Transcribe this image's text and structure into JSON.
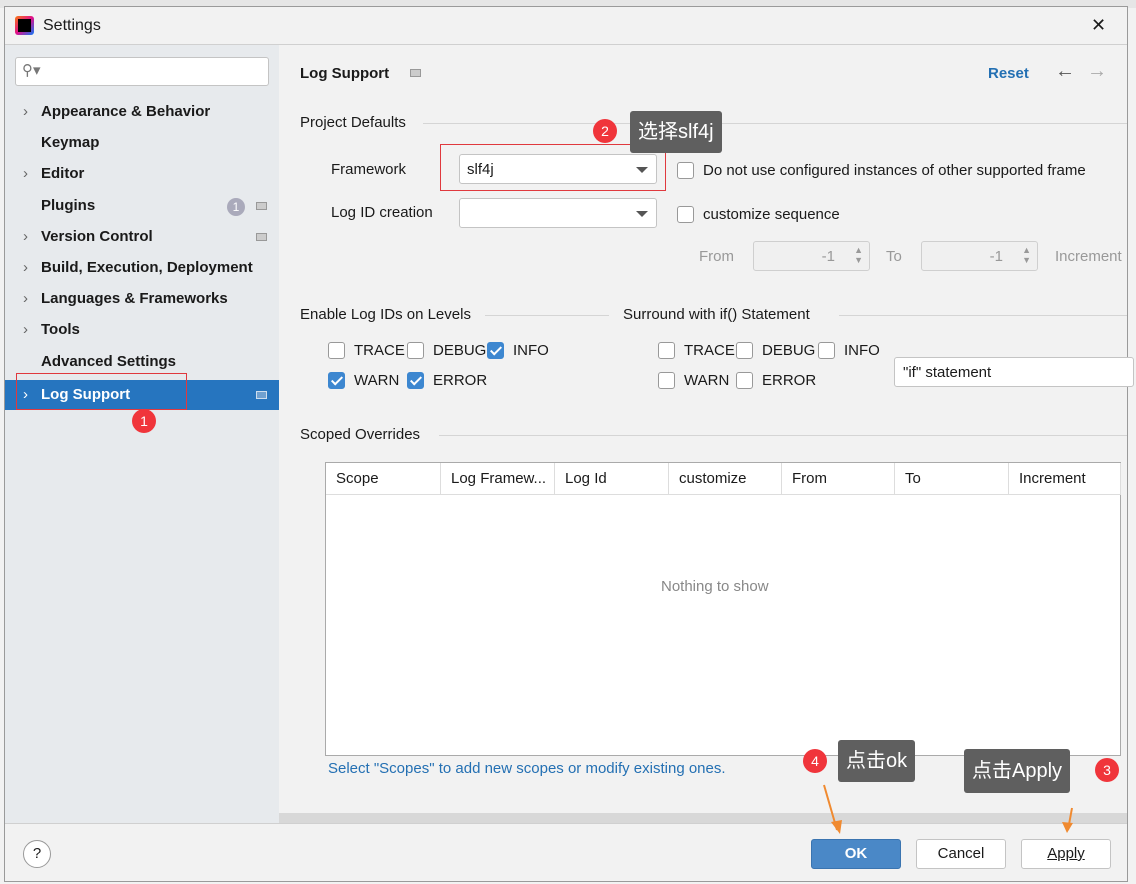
{
  "window": {
    "title": "Settings",
    "close": "✕"
  },
  "search": {
    "placeholder": ""
  },
  "sidebar": {
    "items": [
      {
        "label": "Appearance & Behavior",
        "chevron": true
      },
      {
        "label": "Keymap",
        "chevron": false
      },
      {
        "label": "Editor",
        "chevron": true
      },
      {
        "label": "Plugins",
        "chevron": false,
        "badge": "1"
      },
      {
        "label": "Version Control",
        "chevron": true
      },
      {
        "label": "Build, Execution, Deployment",
        "chevron": true
      },
      {
        "label": "Languages & Frameworks",
        "chevron": true
      },
      {
        "label": "Tools",
        "chevron": true
      },
      {
        "label": "Advanced Settings",
        "chevron": false
      },
      {
        "label": "Log Support",
        "chevron": true,
        "selected": true
      }
    ]
  },
  "header": {
    "title": "Log Support",
    "reset": "Reset"
  },
  "project_defaults": {
    "title": "Project Defaults",
    "framework_label": "Framework",
    "framework_value": "slf4j",
    "no_configured_label": "Do not use configured instances of other supported frame",
    "log_id_label": "Log ID creation",
    "log_id_value": "",
    "customize_label": "customize sequence",
    "from_label": "From",
    "from_value": "-1",
    "to_label": "To",
    "to_value": "-1",
    "increment_label": "Increment"
  },
  "levels": {
    "title": "Enable Log IDs on Levels",
    "items": [
      {
        "label": "TRACE",
        "checked": false
      },
      {
        "label": "DEBUG",
        "checked": false
      },
      {
        "label": "INFO",
        "checked": true
      },
      {
        "label": "WARN",
        "checked": true
      },
      {
        "label": "ERROR",
        "checked": true
      }
    ]
  },
  "surround": {
    "title": "Surround with if() Statement",
    "items": [
      {
        "label": "TRACE",
        "checked": false
      },
      {
        "label": "DEBUG",
        "checked": false
      },
      {
        "label": "INFO",
        "checked": false
      },
      {
        "label": "WARN",
        "checked": false
      },
      {
        "label": "ERROR",
        "checked": false
      }
    ],
    "statement": "\"if\" statement"
  },
  "scoped": {
    "title": "Scoped Overrides",
    "columns": [
      "Scope",
      "Log Framew...",
      "Log Id",
      "customize",
      "From",
      "To",
      "Increment"
    ],
    "empty": "Nothing to show",
    "hint": "Select \"Scopes\" to add new scopes or modify existing ones."
  },
  "buttons": {
    "ok": "OK",
    "cancel": "Cancel",
    "apply": "Apply",
    "help": "?"
  },
  "annotations": {
    "b1": "1",
    "b2": "2",
    "t2": "选择slf4j",
    "b3": "3",
    "t3": "点击Apply",
    "b4": "4",
    "t4": "点击ok"
  },
  "colors": {
    "accent": "#2675bf",
    "badge": "#f0353b",
    "arrow": "#f08a30"
  }
}
